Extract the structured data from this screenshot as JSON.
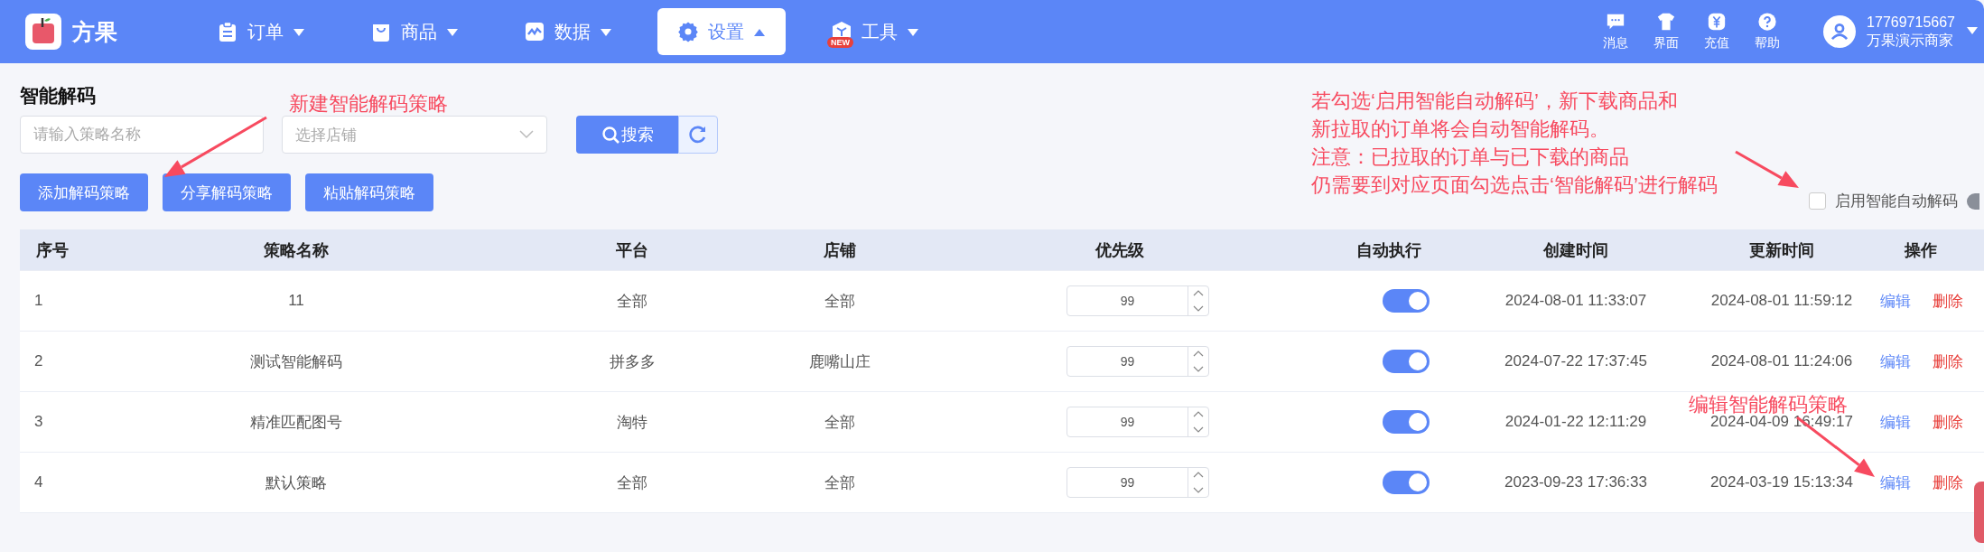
{
  "brand": {
    "name": "方果"
  },
  "nav": [
    {
      "label": "订单",
      "kind": "clipboard",
      "selected": false
    },
    {
      "label": "商品",
      "kind": "bag",
      "selected": false
    },
    {
      "label": "数据",
      "kind": "chart",
      "selected": false
    },
    {
      "label": "设置",
      "kind": "gear",
      "selected": true
    },
    {
      "label": "工具",
      "kind": "cube",
      "selected": false,
      "badge": "NEW"
    }
  ],
  "top_actions": [
    {
      "label": "消息",
      "kind": "chat"
    },
    {
      "label": "界面",
      "kind": "shirt"
    },
    {
      "label": "充值",
      "kind": "yen"
    },
    {
      "label": "帮助",
      "kind": "help"
    }
  ],
  "user": {
    "phone": "17769715667",
    "name": "万果演示商家"
  },
  "page_title": "智能解码",
  "filters": {
    "name_field": {
      "placeholder": "请输入策略名称"
    },
    "shop_select": {
      "placeholder": "选择店铺"
    },
    "search_button": "搜索"
  },
  "actions": [
    "添加解码策略",
    "分享解码策略",
    "粘贴解码策略"
  ],
  "auto_decode": {
    "label": "启用智能自动解码",
    "checked": false
  },
  "table": {
    "columns": [
      "序号",
      "策略名称",
      "平台",
      "店铺",
      "优先级",
      "自动执行",
      "创建时间",
      "更新时间",
      "操作"
    ],
    "rows": [
      {
        "index": "1",
        "name": "11",
        "platform": "全部",
        "shop": "全部",
        "priority": "99",
        "auto": true,
        "created": "2024-08-01 11:33:07",
        "updated": "2024-08-01 11:59:12",
        "edit": "编辑",
        "delete": "删除"
      },
      {
        "index": "2",
        "name": "测试智能解码",
        "platform": "拼多多",
        "shop": "鹿嘴山庄",
        "priority": "99",
        "auto": true,
        "created": "2024-07-22 17:37:45",
        "updated": "2024-08-01 11:24:06",
        "edit": "编辑",
        "delete": "删除"
      },
      {
        "index": "3",
        "name": "精准匹配图号",
        "platform": "淘特",
        "shop": "全部",
        "priority": "99",
        "auto": true,
        "created": "2024-01-22 12:11:29",
        "updated": "2024-04-09 16:49:17",
        "edit": "编辑",
        "delete": "删除"
      },
      {
        "index": "4",
        "name": "默认策略",
        "platform": "全部",
        "shop": "全部",
        "priority": "99",
        "auto": true,
        "created": "2023-09-23 17:36:33",
        "updated": "2024-03-19 15:13:34",
        "edit": "编辑",
        "delete": "删除"
      }
    ]
  },
  "annotations": [
    {
      "kind": "add",
      "text": "新建智能解码策略"
    },
    {
      "kind": "auto",
      "lines": [
        "若勾选‘启用智能自动解码’，新下载商品和",
        "新拉取的订单将会自动智能解码。",
        "注意：已拉取的订单与已下载的商品",
        "仍需要到对应页面勾选点击‘智能解码’进行解码"
      ]
    },
    {
      "kind": "edit",
      "text": "编辑智能解码策略"
    }
  ]
}
